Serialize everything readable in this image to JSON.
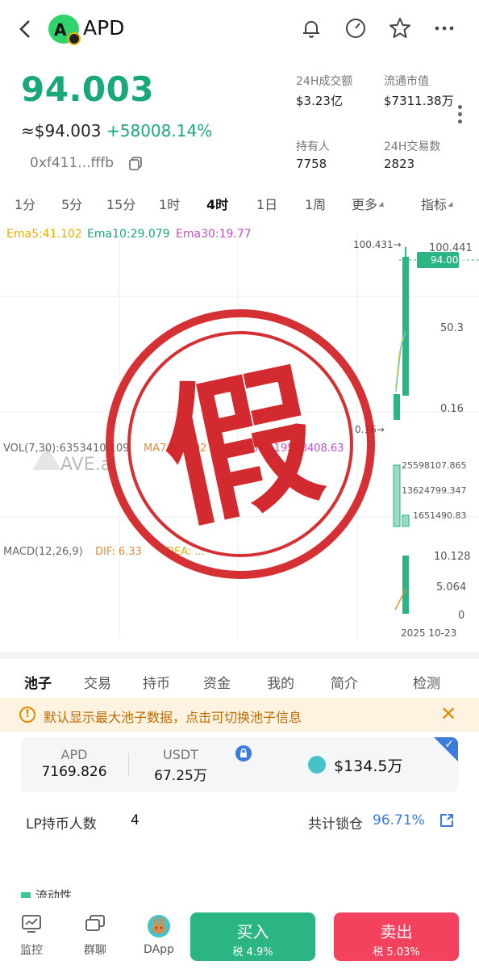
{
  "header": {
    "back_icon": "chevron-left-icon",
    "symbol": "APD",
    "logo_letter": "A",
    "icons": [
      "bell-icon",
      "speedometer-icon",
      "star-icon",
      "more-icon"
    ]
  },
  "price": {
    "value": "94.003",
    "usd": "≈$94.003",
    "change": "+58008.14%",
    "address": "0xf411...fffb"
  },
  "stats": {
    "volume_label": "24H成交额",
    "volume_value": "$3.23亿",
    "mcap_label": "流通市值",
    "mcap_value": "$7311.38万",
    "holders_label": "持有人",
    "holders_value": "7758",
    "tx_label": "24H交易数",
    "tx_value": "2823"
  },
  "timeframes": [
    "1分",
    "5分",
    "15分",
    "1时",
    "4时",
    "1日",
    "1周",
    "更多",
    "指标"
  ],
  "timeframe_active": "4时",
  "indicators": {
    "ema5": "Ema5:41.102",
    "ema10": "Ema10:29.079",
    "ema30": "Ema30:19.77",
    "vol": "VOL(7,30):6353410.109",
    "ma7": "MA7:6...792",
    "ma30": "M...19548408.63",
    "macd": "MACD(12,26,9)",
    "dif": "DIF: 6.33",
    "dea": "DEA: ..."
  },
  "chart_labels": {
    "high_marker": "100.431→",
    "axis_top": "100.441",
    "current_tag": "94.003",
    "axis_mid": "50.3",
    "axis_low": "0.16",
    "low_marker": "0.16→",
    "vol1": "25598107.865",
    "vol2": "13624799.347",
    "vol3": "1651490.83",
    "macd1": "10.128",
    "macd2": "5.064",
    "macd3": "0",
    "date": "2025 10-23",
    "watermark": "AVE.ai",
    "stamp_char": "假"
  },
  "colors": {
    "green": "#19a87a",
    "red_stamp": "#d11f24",
    "blue": "#3b7bdc",
    "buy": "#2bb583",
    "sell": "#f2425d"
  },
  "tabs": [
    "池子",
    "交易",
    "持币",
    "资金",
    "我的",
    "简介",
    "检测"
  ],
  "tab_active": "池子",
  "notice": {
    "text": "默认显示最大池子数据，点击可切换池子信息",
    "close": "✕"
  },
  "pool": {
    "token_a_label": "APD",
    "token_a_value": "7169.826",
    "token_b_label": "USDT",
    "token_b_value": "67.25万",
    "tvl": "$134.5万"
  },
  "lp": {
    "holders_label": "LP持币人数",
    "holders_value": "4",
    "locked_label": "共计锁仓",
    "locked_value": "96.71%"
  },
  "liquidity_label": "流动性",
  "nav": {
    "monitor": "监控",
    "group": "群聊",
    "dapp": "DApp",
    "buy": "买入",
    "buy_tax": "税 4.9%",
    "sell": "卖出",
    "sell_tax": "税 5.03%"
  }
}
